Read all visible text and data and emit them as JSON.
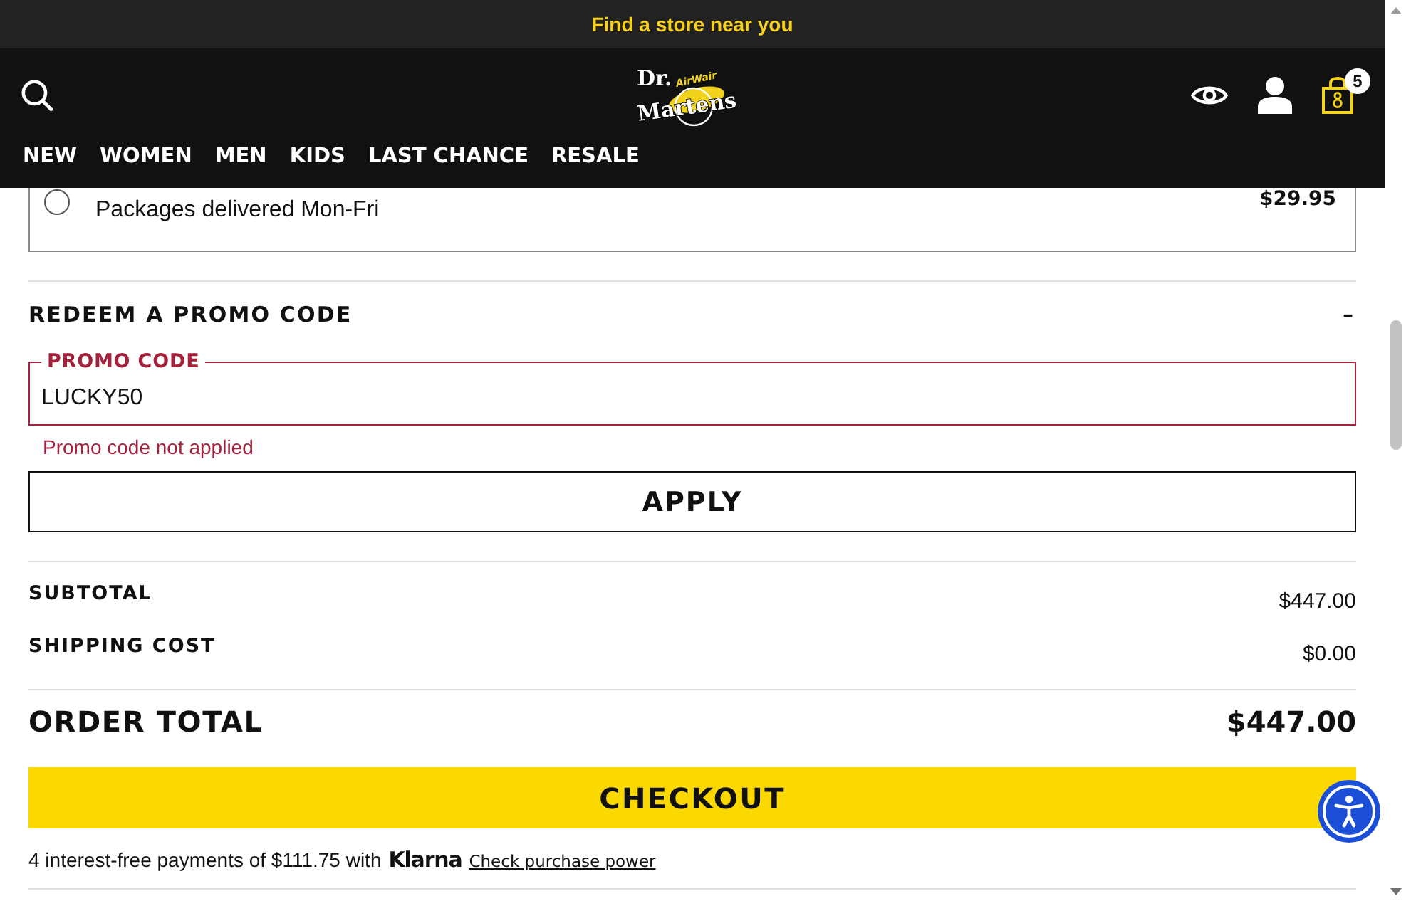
{
  "top_banner": {
    "text": "Find a store near you"
  },
  "header": {
    "logo": {
      "line_1": "Dr.",
      "line_2": "Martens",
      "tagline": "AirWair"
    },
    "cart_count": "5",
    "nav": [
      "NEW",
      "WOMEN",
      "MEN",
      "KIDS",
      "LAST CHANCE",
      "RESALE"
    ]
  },
  "shipping_option": {
    "selected": false,
    "description": "Packages delivered Mon-Fri",
    "price": "$29.95"
  },
  "promo": {
    "title": "REDEEM A PROMO CODE",
    "toggle": "–",
    "field": {
      "label": "PROMO CODE",
      "value": "LUCKY50",
      "error": "Promo code not applied"
    },
    "button": "APPLY"
  },
  "summary": {
    "rows": [
      {
        "label": "SUBTOTAL",
        "value": "$447.00"
      },
      {
        "label": "SHIPPING COST",
        "value": "$0.00"
      }
    ],
    "total": {
      "label": "ORDER TOTAL",
      "value": "$447.00"
    }
  },
  "checkout": {
    "button": "CHECKOUT",
    "installments": {
      "text": "4 interest-free payments of $111.75 with",
      "provider": "Klarna",
      "link": "Check purchase power"
    }
  }
}
